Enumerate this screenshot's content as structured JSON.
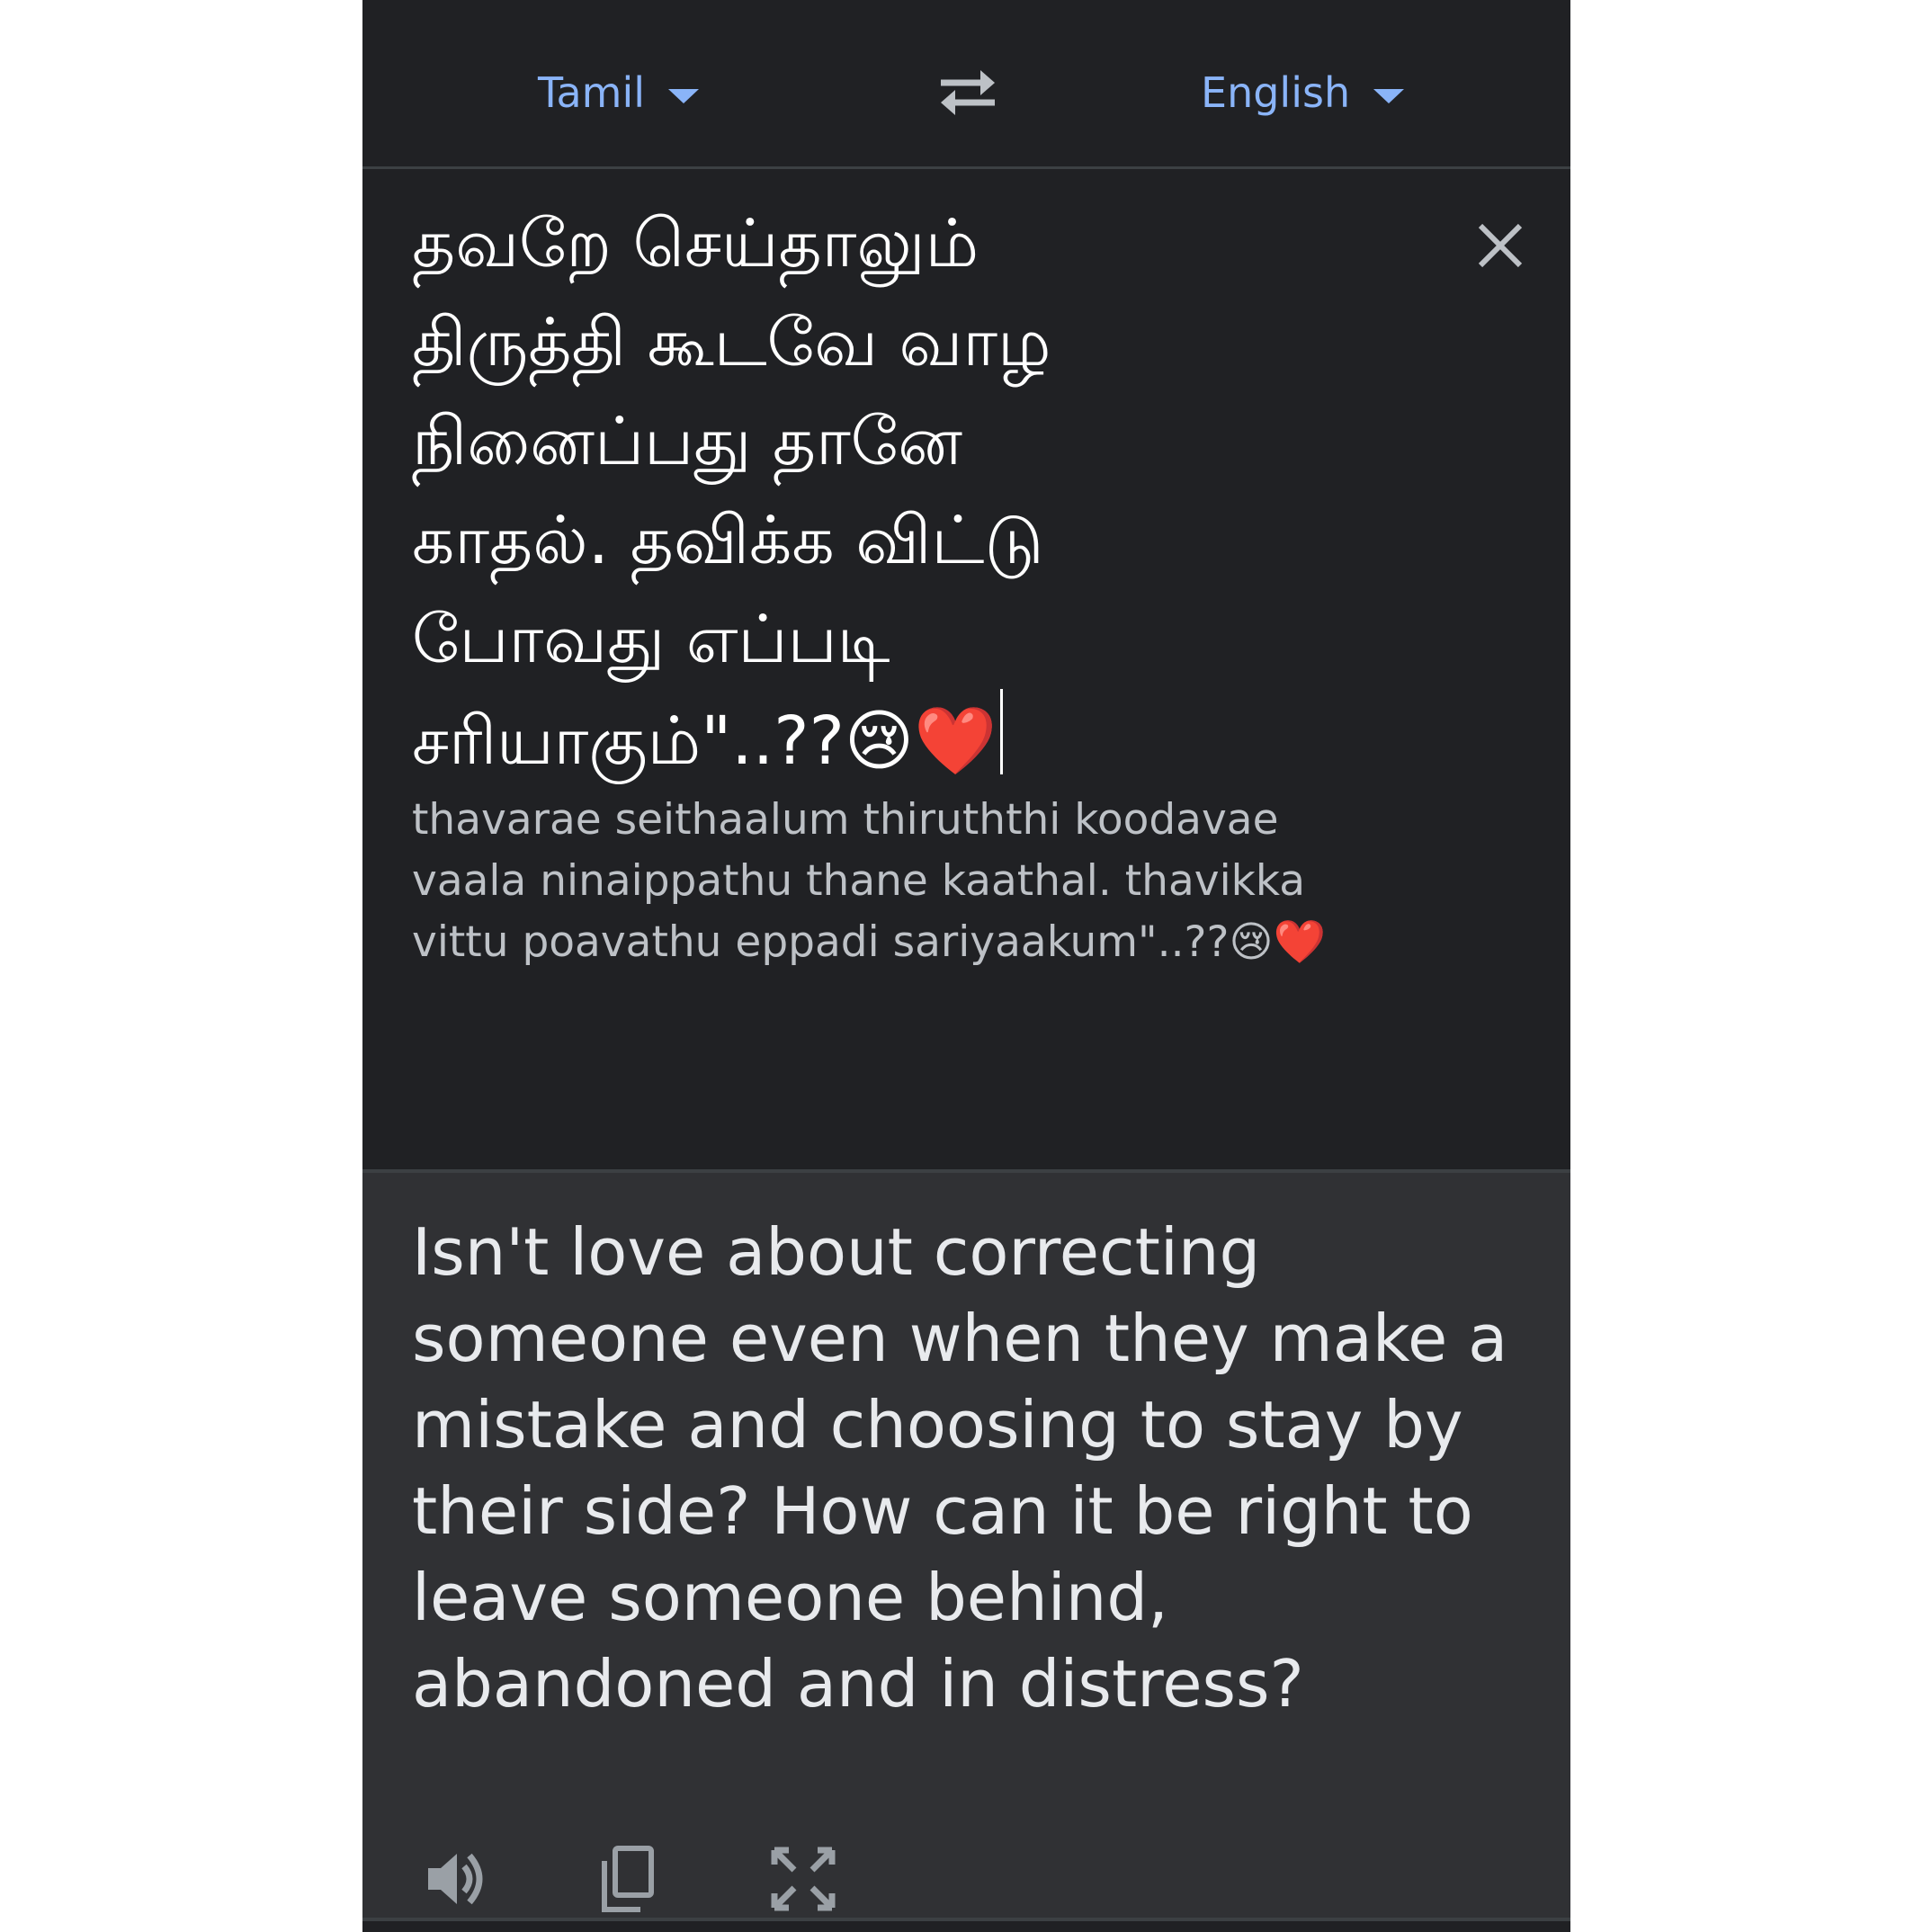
{
  "header": {
    "source_language": "Tamil",
    "target_language": "English",
    "swap_icon": "swap-arrows-icon"
  },
  "source": {
    "text": "தவறே செய்தாலும்\nதிருத்தி கூடவே வாழ\nநினைப்பது தானே\nகாதல். தவிக்க விட்டு\nபோவது எப்படி\nசரியாகும்\"..??😢❤️",
    "transliteration": "thavarae seithaalum thiruththi koodavae\nvaala ninaippathu thane kaathal. thavikka\nvittu poavathu eppadi sariyaakum\"..??😢❤️",
    "icons": [
      "close-icon",
      "speaker-icon",
      "microphone-icon",
      "camera-icon"
    ]
  },
  "target": {
    "text": "Isn't love about correcting someone even when they make a mistake and choosing to stay by their side? How can it be right to leave someone behind, abandoned and in distress?",
    "icons": [
      "speaker-icon",
      "copy-icon",
      "fullscreen-icon"
    ]
  },
  "colors": {
    "background": "#202124",
    "target_background": "#303134",
    "accent": "#8ab4f8",
    "icon": "#9aa0a6"
  }
}
